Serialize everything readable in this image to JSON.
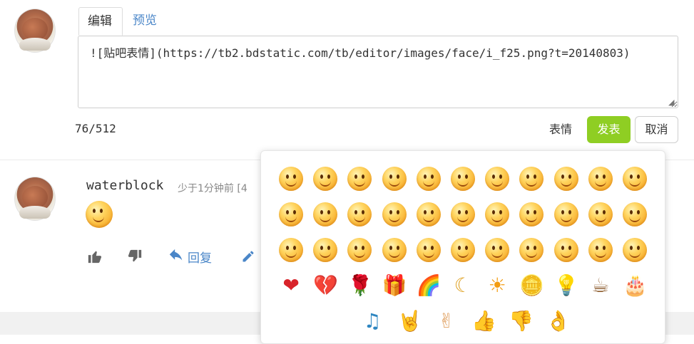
{
  "editor": {
    "tabs": [
      {
        "label": "编辑",
        "active": true
      },
      {
        "label": "预览",
        "active": false
      }
    ],
    "content": "![贴吧表情](https://tb2.bdstatic.com/tb/editor/images/face/i_f25.png?t=20140803)",
    "counter": "76/512",
    "emoji_button": "表情",
    "post_button": "发表",
    "cancel_button": "取消"
  },
  "comment": {
    "username": "waterblock",
    "time_ago": "少于1分钟前 [4",
    "actions": {
      "reply": "回复"
    }
  },
  "emoji_picker": {
    "rows": [
      [
        "smile",
        "laugh",
        "tongue",
        "grimace",
        "sunglasses",
        "angry",
        "happy",
        "sweat",
        "cry",
        "shy",
        "hide"
      ],
      [
        "annoyed",
        "think",
        "money",
        "confused",
        "blush",
        "sick",
        "surprised",
        "grumpy",
        "love-eyes",
        "wink",
        "disgust"
      ],
      [
        "grin",
        "cover-mouth",
        "giggle",
        "cheeky",
        "tears",
        "pleading",
        "sleepy",
        "scared",
        "furious",
        "shocked",
        "vomit"
      ],
      [
        "hearts",
        "broken-heart",
        "rose",
        "gift",
        "rainbow",
        "moon",
        "sun",
        "coins",
        "bulb",
        "tea",
        "cake"
      ],
      [
        "music",
        "rock-hand",
        "victory",
        "thumbs-up",
        "thumbs-down",
        "ok-hand"
      ]
    ],
    "glyphs": {
      "hearts": "❤",
      "broken-heart": "💔",
      "rose": "🌹",
      "gift": "🎁",
      "rainbow": "🌈",
      "moon": "☾",
      "sun": "☀",
      "coins": "🪙",
      "bulb": "💡",
      "tea": "☕",
      "cake": "🎂",
      "music": "♫",
      "rock-hand": "🤘",
      "victory": "✌",
      "thumbs-up": "👍",
      "thumbs-down": "👎",
      "ok-hand": "👌"
    },
    "colors": {
      "accent": "#8fce23",
      "link": "#4a86c8"
    }
  }
}
